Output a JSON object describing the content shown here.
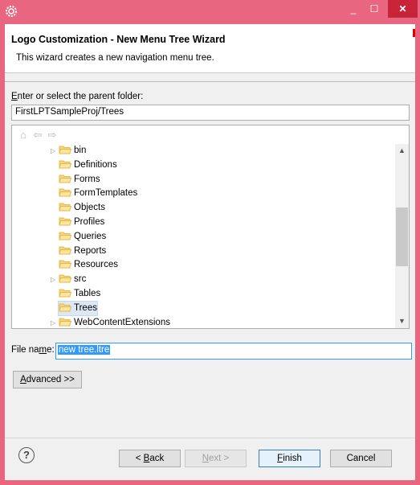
{
  "window": {
    "controls": {
      "minimize": "_",
      "maximize": "☐",
      "close": "✕"
    }
  },
  "header": {
    "title": "Logo Customization - New Menu Tree Wizard",
    "description": "This wizard creates a new navigation menu tree."
  },
  "parent_folder": {
    "label_mnemonic": "E",
    "label_rest": "nter or select the parent folder:",
    "value": "FirstLPTSampleProj/Trees"
  },
  "tree": {
    "items": [
      {
        "label": "bin",
        "expandable": true,
        "selected": false
      },
      {
        "label": "Definitions",
        "expandable": false,
        "selected": false
      },
      {
        "label": "Forms",
        "expandable": false,
        "selected": false
      },
      {
        "label": "FormTemplates",
        "expandable": false,
        "selected": false
      },
      {
        "label": "Objects",
        "expandable": false,
        "selected": false
      },
      {
        "label": "Profiles",
        "expandable": false,
        "selected": false
      },
      {
        "label": "Queries",
        "expandable": false,
        "selected": false
      },
      {
        "label": "Reports",
        "expandable": false,
        "selected": false
      },
      {
        "label": "Resources",
        "expandable": false,
        "selected": false
      },
      {
        "label": "src",
        "expandable": true,
        "selected": false
      },
      {
        "label": "Tables",
        "expandable": false,
        "selected": false
      },
      {
        "label": "Trees",
        "expandable": false,
        "selected": true
      },
      {
        "label": "WebContentExtensions",
        "expandable": true,
        "selected": false
      }
    ]
  },
  "file_name": {
    "label_pre": "File na",
    "label_mnemonic": "m",
    "label_post": "e:",
    "value": "new tree.ltre"
  },
  "buttons": {
    "advanced": {
      "mnemonic": "A",
      "rest": "dvanced >>"
    },
    "back": {
      "pre": "< ",
      "mnemonic": "B",
      "rest": "ack"
    },
    "next": {
      "mnemonic": "N",
      "rest": "ext >"
    },
    "finish": {
      "mnemonic": "F",
      "rest": "inish"
    },
    "cancel": "Cancel",
    "help": "?"
  },
  "colors": {
    "title_bar": "#e8667f",
    "close_button": "#c7243a",
    "selection": "#3399ff",
    "folder": "#e8b84a"
  }
}
